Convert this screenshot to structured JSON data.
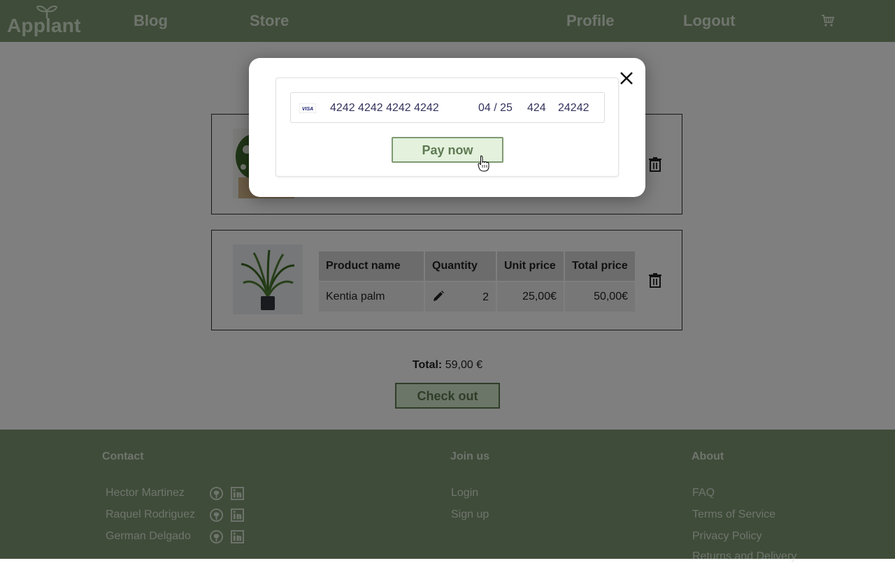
{
  "navbar": {
    "logo_text": "Applant",
    "links": {
      "blog": "Blog",
      "store": "Store",
      "profile": "Profile",
      "logout": "Logout"
    },
    "cart_icon": "cart-icon"
  },
  "cart": {
    "items": [
      {
        "name": "",
        "quantity": "",
        "unit_price": "",
        "total_price": ""
      },
      {
        "name": "Kentia palm",
        "quantity": "2",
        "unit_price": "25,00€",
        "total_price": "50,00€"
      }
    ],
    "headers": {
      "product_name": "Product name",
      "quantity": "Quantity",
      "unit_price": "Unit price",
      "total_price": "Total price"
    },
    "total_label": "Total:",
    "total_value": "59,00 €",
    "checkout_label": "Check out"
  },
  "payment_modal": {
    "card_brand": "VISA",
    "card_number": "4242 4242 4242 4242",
    "expiry": "04 / 25",
    "cvc": "424",
    "zip": "24242",
    "pay_label": "Pay now",
    "close_icon": "close-icon"
  },
  "footer": {
    "contact": {
      "heading": "Contact",
      "people": [
        "Hector Martinez",
        "Raquel Rodriguez",
        "German Delgado"
      ],
      "icons": [
        "github-icon",
        "linkedin-icon"
      ]
    },
    "join": {
      "heading": "Join us",
      "links": [
        "Login",
        "Sign up"
      ]
    },
    "about": {
      "heading": "About",
      "links": [
        "FAQ",
        "Terms of Service",
        "Privacy Policy",
        "Returns and Delivery"
      ]
    }
  },
  "colors": {
    "brand_green": "#7f9872",
    "button_bg": "#e3f1dd",
    "button_border": "#7f9a72",
    "overlay": "rgba(0,0,0,0.5)"
  }
}
